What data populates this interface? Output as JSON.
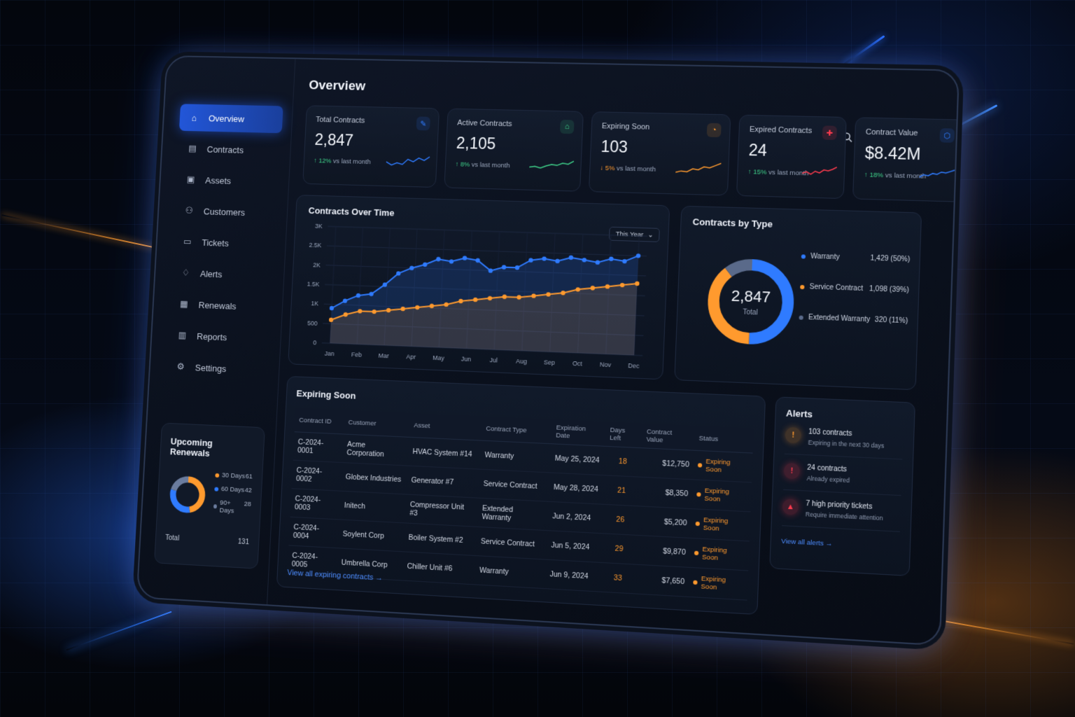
{
  "colors": {
    "accent_blue": "#2f7bff",
    "accent_orange": "#ff9a2e",
    "positive_green": "#3fd28a",
    "danger_red": "#ff3b4e",
    "background": "#05090f"
  },
  "nav": {
    "items": [
      {
        "label": "Overview",
        "icon": "home-icon",
        "active": true
      },
      {
        "label": "Contracts",
        "icon": "document-icon",
        "active": false
      },
      {
        "label": "Assets",
        "icon": "box-icon",
        "active": false
      },
      {
        "label": "Customers",
        "icon": "users-icon",
        "active": false
      },
      {
        "label": "Tickets",
        "icon": "ticket-icon",
        "active": false
      },
      {
        "label": "Alerts",
        "icon": "bell-icon",
        "active": false
      },
      {
        "label": "Renewals",
        "icon": "calendar-icon",
        "active": false
      },
      {
        "label": "Reports",
        "icon": "bar-chart-icon",
        "active": false
      },
      {
        "label": "Settings",
        "icon": "gear-icon",
        "active": false
      }
    ]
  },
  "upcoming_renewals": {
    "title": "Upcoming Renewals",
    "rows": [
      {
        "label": "30 Days",
        "value": "61",
        "color": "#ff9a2e"
      },
      {
        "label": "60 Days",
        "value": "42",
        "color": "#2f7bff"
      },
      {
        "label": "90+ Days",
        "value": "28",
        "color": "#6b7c9e"
      }
    ],
    "total_label": "Total",
    "total_value": "131"
  },
  "header": {
    "title": "Overview",
    "icons": [
      "search-icon",
      "bell-icon",
      "avatar",
      "chevron-down-icon"
    ]
  },
  "kpis": [
    {
      "label": "Total Contracts",
      "value": "2,847",
      "change": "12%",
      "change_dir": "up",
      "suffix": "vs last month",
      "icon_color": "#2f7bff",
      "spark_color": "#2f7bff"
    },
    {
      "label": "Active Contracts",
      "value": "2,105",
      "change": "8%",
      "change_dir": "up",
      "suffix": "vs last month",
      "icon_color": "#3fd28a",
      "spark_color": "#3fd28a"
    },
    {
      "label": "Expiring Soon",
      "value": "103",
      "change": "5%",
      "change_dir": "down",
      "suffix": "vs last month",
      "icon_color": "#ff9a2e",
      "spark_color": "#ff9a2e"
    },
    {
      "label": "Expired Contracts",
      "value": "24",
      "change": "15%",
      "change_dir": "up",
      "suffix": "vs last month",
      "icon_color": "#ff3b4e",
      "spark_color": "#ff3b4e"
    },
    {
      "label": "Contract Value",
      "value": "$8.42M",
      "change": "18%",
      "change_dir": "up",
      "suffix": "vs last month",
      "icon_color": "#2f7bff",
      "spark_color": "#2f7bff"
    }
  ],
  "contracts_over_time": {
    "title": "Contracts Over Time",
    "range_label": "This Year"
  },
  "chart_data": {
    "type": "line",
    "categories": [
      "Jan",
      "Feb",
      "Mar",
      "Apr",
      "May",
      "Jun",
      "Jul",
      "Aug",
      "Sep",
      "Oct",
      "Nov",
      "Dec"
    ],
    "series": [
      {
        "values": [
          900,
          1100,
          1250,
          1300,
          1550,
          1850,
          2000,
          2100,
          2250,
          2200,
          2300,
          2250,
          2000,
          2100,
          2100,
          2300,
          2350,
          2300,
          2400,
          2350,
          2300,
          2400,
          2350,
          2500
        ],
        "color": "#2f7bff"
      },
      {
        "values": [
          600,
          750,
          850,
          850,
          900,
          950,
          1000,
          1050,
          1100,
          1200,
          1250,
          1300,
          1350,
          1350,
          1400,
          1450,
          1500,
          1600,
          1650,
          1700,
          1750,
          1800
        ],
        "color": "#ff9a2e"
      }
    ],
    "yticks": [
      "0",
      "500",
      "1K",
      "1.5K",
      "2K",
      "2.5K",
      "3K"
    ],
    "ylim": [
      0,
      3000
    ],
    "grid": true
  },
  "contracts_by_type": {
    "title": "Contracts by Type",
    "total_value": "2,847",
    "total_label": "Total",
    "items": [
      {
        "label": "Warranty",
        "value": "1,429 (50%)",
        "pct": 50,
        "color": "#2f7bff"
      },
      {
        "label": "Service Contract",
        "value": "1,098 (39%)",
        "pct": 39,
        "color": "#ff9a2e"
      },
      {
        "label": "Extended Warranty",
        "value": "320 (11%)",
        "pct": 11,
        "color": "#5a6a8a"
      }
    ]
  },
  "expiring_table": {
    "title": "Expiring Soon",
    "columns": [
      "Contract ID",
      "Customer",
      "Asset",
      "Contract Type",
      "Expiration Date",
      "Days Left",
      "Contract Value",
      "Status"
    ],
    "rows": [
      [
        "C-2024-0001",
        "Acme Corporation",
        "HVAC System #14",
        "Warranty",
        "May 25, 2024",
        "18",
        "$12,750",
        "Expiring Soon"
      ],
      [
        "C-2024-0002",
        "Globex Industries",
        "Generator #7",
        "Service Contract",
        "May 28, 2024",
        "21",
        "$8,350",
        "Expiring Soon"
      ],
      [
        "C-2024-0003",
        "Initech",
        "Compressor Unit #3",
        "Extended Warranty",
        "Jun 2, 2024",
        "26",
        "$5,200",
        "Expiring Soon"
      ],
      [
        "C-2024-0004",
        "Soylent Corp",
        "Boiler System #2",
        "Service Contract",
        "Jun 5, 2024",
        "29",
        "$9,870",
        "Expiring Soon"
      ],
      [
        "C-2024-0005",
        "Umbrella Corp",
        "Chiller Unit #6",
        "Warranty",
        "Jun 9, 2024",
        "33",
        "$7,650",
        "Expiring Soon"
      ]
    ],
    "link": "View all expiring contracts →"
  },
  "alerts": {
    "title": "Alerts",
    "items": [
      {
        "title": "103 contracts",
        "subtitle": "Expiring in the next 30 days",
        "icon": "warning-icon",
        "color": "#ff9a2e"
      },
      {
        "title": "24 contracts",
        "subtitle": "Already expired",
        "icon": "alert-icon",
        "color": "#ff3b4e"
      },
      {
        "title": "7 high priority tickets",
        "subtitle": "Require immediate attention",
        "icon": "ticket-alert-icon",
        "color": "#ff3b4e"
      }
    ],
    "link": "View all alerts →"
  }
}
